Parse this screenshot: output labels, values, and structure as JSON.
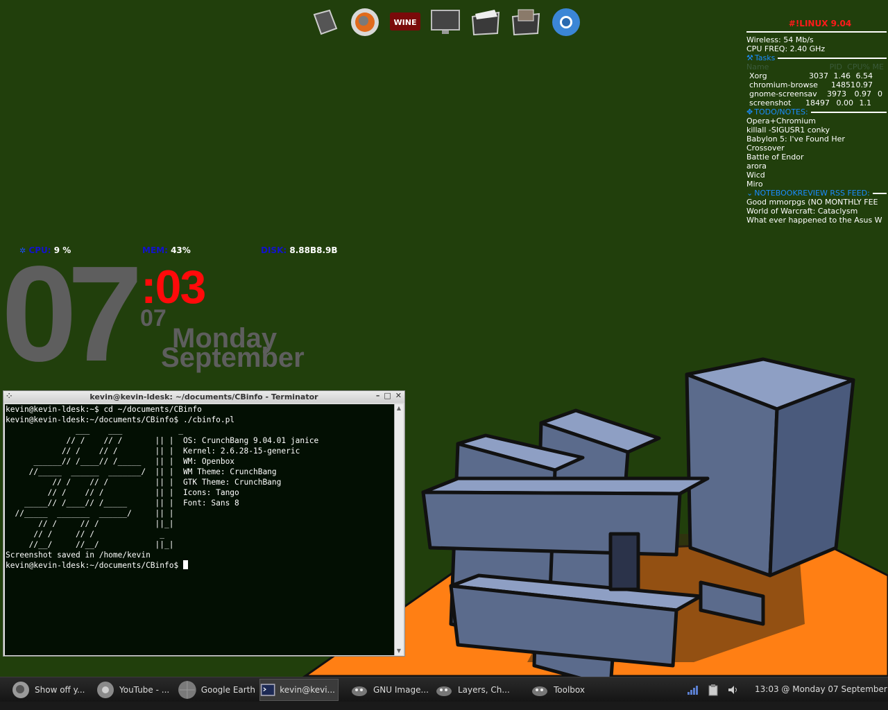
{
  "conky": {
    "title": "#!LINUX 9.04",
    "wireless": "Wireless: 54 Mb/s",
    "cpu_freq": "CPU FREQ: 2.40 GHz",
    "tasks_label": "Tasks",
    "task_headers": [
      "Name",
      "PID",
      "CPU%",
      "ME"
    ],
    "tasks": [
      {
        "name": "Xorg",
        "pid": "3037",
        "cpu": "1.46",
        "mem": "6.54"
      },
      {
        "name": "chromium-browse",
        "pid": "14851",
        "cpu": "0.97",
        "mem": ""
      },
      {
        "name": "gnome-screensav",
        "pid": "3973",
        "cpu": "0.97",
        "mem": "0"
      },
      {
        "name": "screenshot",
        "pid": "18497",
        "cpu": "0.00",
        "mem": "1.1"
      }
    ],
    "notes_label": "TODO/NOTES:",
    "notes": [
      "Opera+Chromium",
      "killall -SIGUSR1 conky",
      "Babylon 5: I've Found Her",
      "Crossover",
      "Battle of Endor",
      "arora",
      "Wicd",
      "Miro"
    ],
    "rss_label": "NOTEBOOKREVIEW RSS FEED:",
    "rss": [
      "Good mmorpgs (NO MONTHLY FEE",
      "World of Warcraft: Cataclysm",
      "What ever happened to the Asus W"
    ]
  },
  "stats": {
    "cpu_label": "CPU:",
    "cpu_value": "9 %",
    "mem_label": "MEM:",
    "mem_value": "43%",
    "disk_label": "DISK:",
    "disk_value": "8.88B8.9B"
  },
  "clock": {
    "hour": "07",
    "minute": ":03",
    "day": "07",
    "weekday": "Monday",
    "month": "September"
  },
  "terminal": {
    "title": "kevin@kevin-ldesk: ~/documents/CBinfo - Terminator",
    "lines": [
      "kevin@kevin-ldesk:~$ cd ~/documents/CBinfo",
      "kevin@kevin-ldesk:~/documents/CBinfo$ ./cbinfo.pl",
      "",
      "",
      "               ___    ___            _",
      "             // /    // /       || |  OS: CrunchBang 9.04.01 janice",
      "            // /    // /        || |  Kernel: 2.6.28-15-generic",
      "      ______// /____// /_____   || |  WM: Openbox",
      "     //_____  ______  _______/  || |  WM Theme: CrunchBang",
      "          // /    // /          || |  GTK Theme: CrunchBang",
      "         // /    // /           || |  Icons: Tango",
      "    _____// /____// /_____      || |  Font: Sans 8",
      "  //_____  _______  ______/     || |",
      "       // /     // /            ||_|",
      "      // /     // /              _",
      "     //__/     //__/            ||_|",
      "",
      "Screenshot saved in /home/kevin",
      "kevin@kevin-ldesk:~/documents/CBinfo$ "
    ]
  },
  "taskbar": {
    "items": [
      {
        "label": "Show off y...",
        "icon": "firefox-icon"
      },
      {
        "label": "YouTube - ...",
        "icon": "chromium-icon"
      },
      {
        "label": "Google Earth",
        "icon": "globe-icon"
      },
      {
        "label": "kevin@kevi...",
        "icon": "terminal-icon"
      },
      {
        "label": "GNU Image...",
        "icon": "gimp-icon"
      },
      {
        "label": "Layers, Ch...",
        "icon": "gimp-icon"
      },
      {
        "label": "Toolbox",
        "icon": "gimp-icon"
      }
    ],
    "clock": "13:03 @ Monday 07 September"
  },
  "colors": {
    "background": "#213f0c",
    "floor": "#ff7f14",
    "logo": "#5b6b8c",
    "clock_red": "#ff0a0a",
    "conky_blue": "#1a8cff"
  }
}
